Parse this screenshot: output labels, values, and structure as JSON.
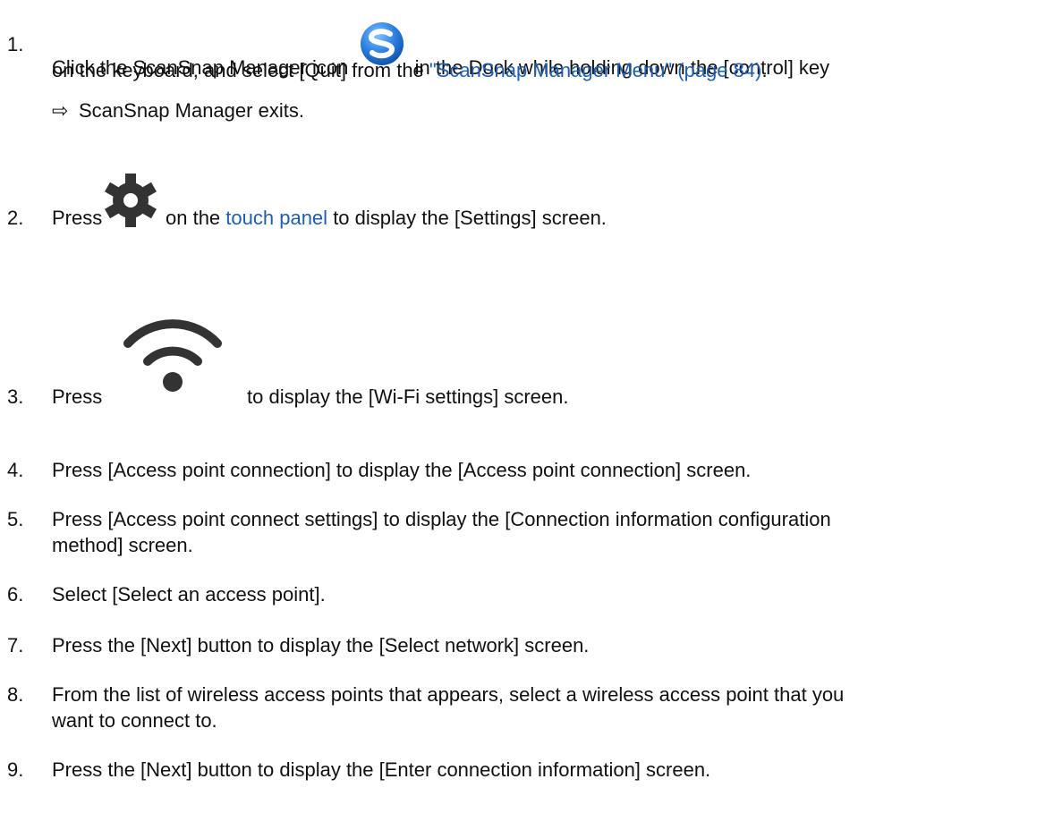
{
  "steps": [
    {
      "number": "1.",
      "line1_before_icon": "Click the ScanSnap Manager icon",
      "icon": "scansnap-manager-icon",
      "line1_after_icon": "in the Dock while holding down the [control] key",
      "line2_before_link": "on the keyboard, and select [Quit] from the",
      "link": "\"ScanSnap Manager Menu\" (page 84)",
      "line2_after_link": ".",
      "result_arrow": "⇨",
      "result_text": "ScanSnap Manager exits."
    },
    {
      "number": "2.",
      "text_before_icon": "Press",
      "icon": "gear-icon",
      "text_middle": "on the",
      "link": "touch panel",
      "text_after_link": "to display the [Settings] screen."
    },
    {
      "number": "3.",
      "text_before_icon": "Press",
      "icon": "wifi-icon",
      "text_after_icon": "to display the [Wi-Fi settings] screen."
    },
    {
      "number": "4.",
      "text": "Press [Access point connection] to display the [Access point connection] screen."
    },
    {
      "number": "5.",
      "line1": "Press [Access point connect settings] to display the [Connection information configuration",
      "line2": "method] screen."
    },
    {
      "number": "6.",
      "text": "Select [Select an access point]."
    },
    {
      "number": "7.",
      "text": "Press the [Next] button to display the [Select network] screen."
    },
    {
      "number": "8.",
      "line1": "From the list of wireless access points that appears, select a wireless access point that you",
      "line2": "want to connect to."
    },
    {
      "number": "9.",
      "text": "Press the [Next] button to display the [Enter connection information] screen."
    }
  ],
  "colors": {
    "text": "#111111",
    "link": "#1f5fad",
    "scansnap_blue": "#1e6fd9",
    "icon_dark": "#333333"
  }
}
